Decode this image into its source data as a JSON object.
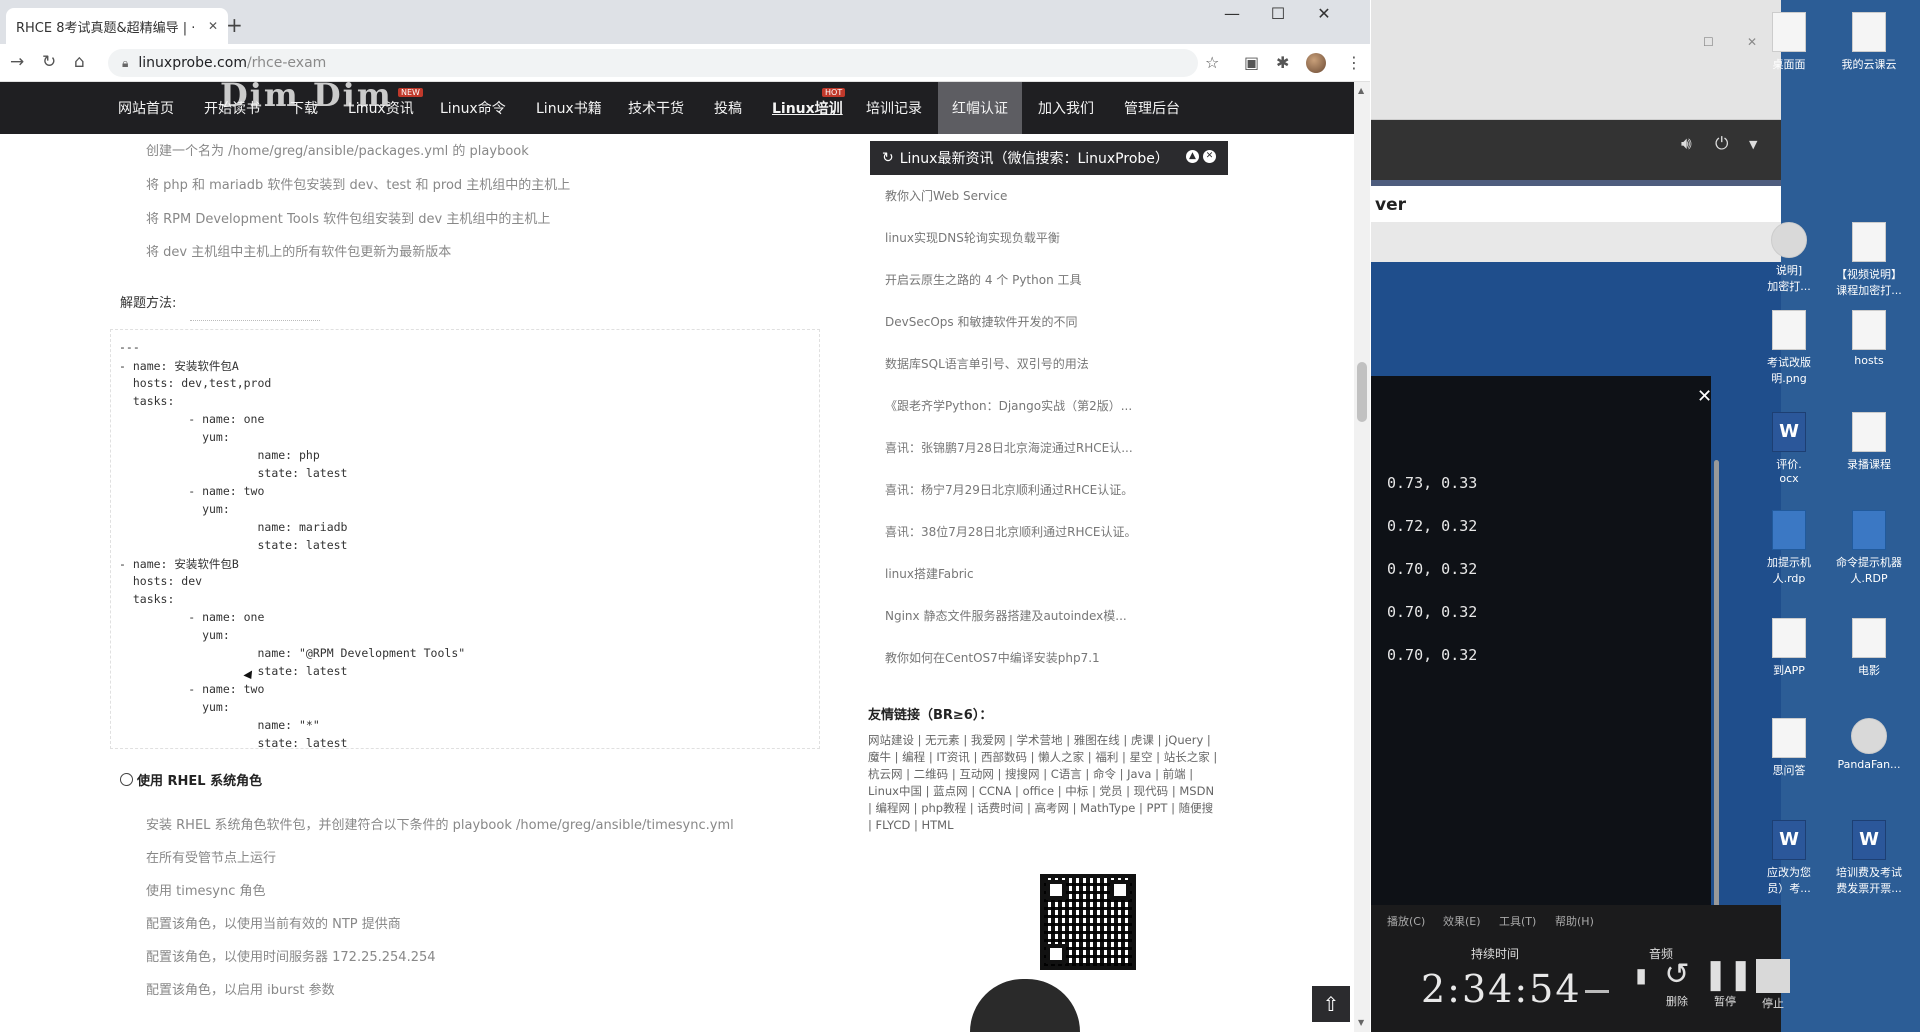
{
  "browser": {
    "tab_title": "RHCE 8考试真题&超精编导 | ·",
    "url_host": "linuxprobe.com",
    "url_path": "/rhce-exam",
    "win_controls": [
      "—",
      "☐",
      "✕"
    ]
  },
  "site_nav": {
    "logo": "Dim Dim",
    "items": [
      {
        "label": "网站首页"
      },
      {
        "label": "开始读书"
      },
      {
        "label": "下载"
      },
      {
        "label": "Linux资讯",
        "badge": "NEW"
      },
      {
        "label": "Linux命令"
      },
      {
        "label": "Linux书籍"
      },
      {
        "label": "技术干货"
      },
      {
        "label": "投稿"
      },
      {
        "label": "Linux培训",
        "badge": "HOT"
      },
      {
        "label": "培训记录"
      },
      {
        "label": "红帽认证"
      },
      {
        "label": "加入我们"
      },
      {
        "label": "管理后台"
      }
    ]
  },
  "article": {
    "task_lines": [
      "创建一个名为 /home/greg/ansible/packages.yml 的 playbook",
      "将 php 和 mariadb 软件包安装到 dev、test 和 prod 主机组中的主机上",
      "将 RPM Development Tools 软件包组安装到 dev 主机组中的主机上",
      "将 dev 主机组中主机上的所有软件包更新为最新版本"
    ],
    "solution_label": "解题方法:",
    "code_lines": [
      "---",
      "- name: 安装软件包A",
      "  hosts: dev,test,prod",
      "  tasks:",
      "          - name: one",
      "            yum:",
      "                    name: php",
      "                    state: latest",
      "          - name: two",
      "            yum:",
      "                    name: mariadb",
      "                    state: latest",
      "- name: 安装软件包B",
      "  hosts: dev",
      "  tasks:",
      "          - name: one",
      "            yum:",
      "                    name: \"@RPM Development Tools\"",
      "                    state: latest",
      "          - name: two",
      "            yum:",
      "                    name: \"*\"",
      "                    state: latest"
    ],
    "section2_title": "使用 RHEL 系统角色",
    "section2_lines": [
      "安装 RHEL 系统角色软件包，并创建符合以下条件的 playbook /home/greg/ansible/timesync.yml",
      "在所有受管节点上运行",
      "使用 timesync 角色",
      "配置该角色，以使用当前有效的 NTP 提供商",
      "配置该角色，以使用时间服务器 172.25.254.254",
      "配置该角色，以启用 iburst 参数"
    ]
  },
  "sidebar": {
    "news_title": "Linux最新资讯（微信搜索：LinuxProbe）",
    "news_items": [
      "教你入门Web Service",
      "linux实现DNS轮询实现负载平衡",
      "开启云原生之路的 4 个 Python 工具",
      "DevSecOps 和敏捷软件开发的不同",
      "数据库SQL语言单引号、双引号的用法",
      "《跟老齐学Python：Django实战（第2版）...",
      "喜讯：张锦鹏7月28日北京海淀通过RHCE认...",
      "喜讯：杨宁7月29日北京顺利通过RHCE认证。",
      "喜讯：38位7月28日北京顺利通过RHCE认证。",
      "linux搭建Fabric",
      "Nginx 静态文件服务器搭建及autoindex模...",
      "教你如何在CentOS7中编译安装php7.1"
    ],
    "friend_title": "友情链接（BR≥6）：",
    "friend_links": "网站建设 | 无元素 | 我爱网 | 学术营地 | 雅图在线 | 虎课 | jQuery | 魔牛 | 编程 | IT资讯 | 西部数码 | 懒人之家 | 福利 | 星空 | 站长之家 | 杭云网 | 二维码 | 互动网 | 搜搜网 | C语言 | 命令 | Java | 前端 | Linux中国 | 蓝点网 | CCNA | office | 中标 | 党员 | 现代码 | MSDN | 编程网 | php教程 | 话费时间 | 高考网 | MathType | PPT | 随便搜 | FLYCD | HTML"
  },
  "desktop": {
    "icons": [
      {
        "label": "桌面面"
      },
      {
        "label": "我的云课云"
      },
      {
        "label": "说明]\n加密打..."
      },
      {
        "label": "【视频说明】\n课程加密打..."
      },
      {
        "label": "考试改版\n明.png"
      },
      {
        "label": "hosts"
      },
      {
        "label": "评价.\nocx"
      },
      {
        "label": "录播课程"
      },
      {
        "label": "加提示机\n人.rdp"
      },
      {
        "label": "命令提示机器\n人.RDP"
      },
      {
        "label": "到APP"
      },
      {
        "label": "电影"
      },
      {
        "label": "思问答"
      },
      {
        "label": "PandaFan..."
      },
      {
        "label": "应改为您\n员）考..."
      },
      {
        "label": "培训费及考试\n费发票开票..."
      }
    ],
    "ver_text": "ver",
    "terminal_lines": [
      "0.73, 0.33",
      "0.72, 0.32",
      "0.70, 0.32",
      "0.70, 0.32",
      "0.70, 0.32"
    ]
  },
  "recorder": {
    "menu": [
      "播放(C)",
      "效果(E)",
      "工具(T)",
      "帮助(H)"
    ],
    "duration_label": "持续时间",
    "audio_label": "音频",
    "time": "2:34:54",
    "delete_label": "删除",
    "pause_label": "暂停",
    "stop_label": "停止"
  }
}
